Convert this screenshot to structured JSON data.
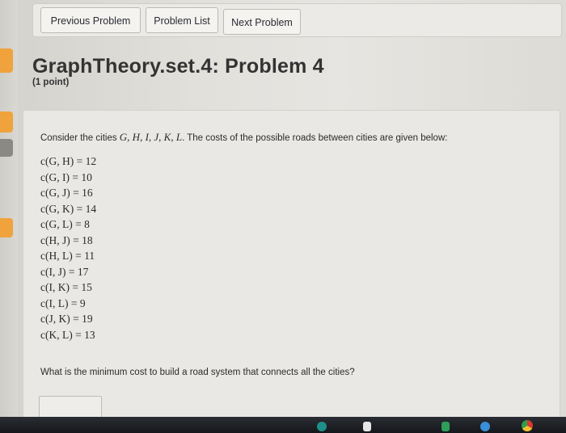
{
  "nav": {
    "previous_label": "Previous Problem",
    "list_label": "Problem List",
    "next_label": "Next Problem"
  },
  "problem": {
    "title": "GraphTheory.set.4: Problem 4",
    "points": "(1 point)",
    "intro_prefix": "Consider the cities ",
    "intro_cities": "G, H, I, J, K, L",
    "intro_suffix": ". The costs of the possible roads between cities are given below:",
    "costs": [
      "c(G, H) = 12",
      "c(G, I) = 10",
      "c(G, J) = 16",
      "c(G, K) = 14",
      "c(G, L) = 8",
      "c(H, J) = 18",
      "c(H, L) = 11",
      "c(I, J) = 17",
      "c(I, K) = 15",
      "c(I, L) = 9",
      "c(J, K) = 19",
      "c(K, L) = 13"
    ],
    "question": "What is the minimum cost to build a road system that connects all the cities?",
    "answer_value": ""
  },
  "colors": {
    "accent_orange": "#f0a23c",
    "taskbar": "#1c1e22"
  },
  "taskbar_icons": [
    "teal-app-icon",
    "files-icon",
    "green-app-icon",
    "chrome-icon"
  ]
}
